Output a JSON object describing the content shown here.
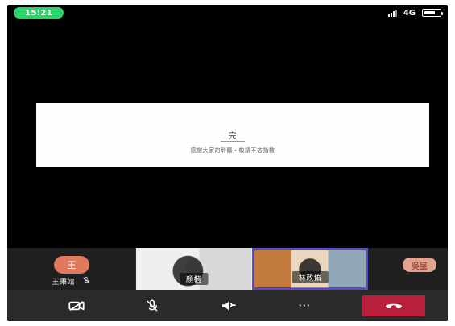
{
  "status_bar": {
    "time": "15:21",
    "network": "4G",
    "battery_level": 0.7,
    "colors": {
      "time_pill": "#2bd36a"
    }
  },
  "shared_screen": {
    "title": "完",
    "subtitle": "感謝大家的聆聽・敬請不吝指教"
  },
  "speaker_indicator": {
    "name": "顏楷",
    "more": "···"
  },
  "participants": [
    {
      "kind": "avatar",
      "avatar_text": "王",
      "name": "王秉靖",
      "mic_icon": "mic-off-icon"
    },
    {
      "kind": "video",
      "name": "顏楷"
    },
    {
      "kind": "video",
      "name": "林政佑",
      "selected": true
    },
    {
      "kind": "avatar",
      "avatar_text": "吳盛"
    }
  ],
  "controls": {
    "camera_off": "camera-off-icon",
    "mic_off": "mic-off-icon",
    "audio_route": "speaker-icon",
    "more": "···",
    "hangup": "hangup-icon",
    "colors": {
      "hangup_bg": "#b81f3a",
      "selected_border": "#5a49c8"
    }
  }
}
